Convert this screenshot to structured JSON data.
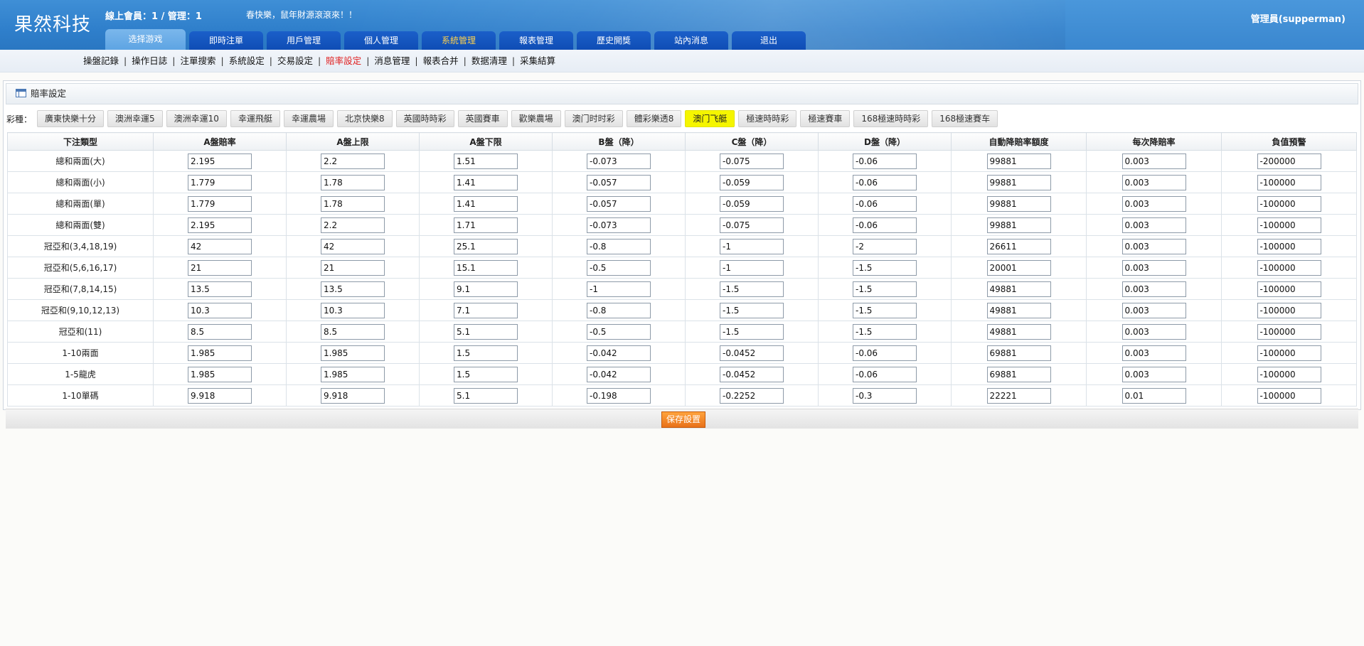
{
  "header": {
    "logo": "果然科技",
    "online_info": "線上會員：1 / 管理：1",
    "marquee": "春快樂，鼠年財源滾滾來！！",
    "admin_info": "管理員(supperman)"
  },
  "nav": [
    "选择游戏",
    "即時注單",
    "用戶管理",
    "個人管理",
    "系統管理",
    "報表管理",
    "歷史開獎",
    "站內消息",
    "退出"
  ],
  "subnav": [
    "操盤記錄",
    "操作日誌",
    "注單搜索",
    "系統設定",
    "交易設定",
    "賠率設定",
    "消息管理",
    "報表合并",
    "数据清理",
    "采集結算"
  ],
  "panel": {
    "title": "賠率設定",
    "lottery_label": "彩種："
  },
  "lotteries": [
    "廣東快樂十分",
    "澳洲幸運5",
    "澳洲幸運10",
    "幸運飛艇",
    "幸運農場",
    "北京快樂8",
    "英國時時彩",
    "英國賽車",
    "歡樂農場",
    "澳门时时彩",
    "體彩樂透8",
    "澳门飞艇",
    "極速時時彩",
    "極速賽車",
    "168極速時時彩",
    "168極速賽车"
  ],
  "active_lottery": "澳门飞艇",
  "table": {
    "headers": [
      "下注類型",
      "A盤賠率",
      "A盤上限",
      "A盤下限",
      "B盤（降）",
      "C盤（降）",
      "D盤（降）",
      "自動降賠率額度",
      "每次降賠率",
      "負值預警"
    ],
    "rows": [
      {
        "type": "總和兩面(大)",
        "values": [
          "2.195",
          "2.2",
          "1.51",
          "-0.073",
          "-0.075",
          "-0.06",
          "99881",
          "0.003",
          "-200000"
        ]
      },
      {
        "type": "總和兩面(小)",
        "values": [
          "1.779",
          "1.78",
          "1.41",
          "-0.057",
          "-0.059",
          "-0.06",
          "99881",
          "0.003",
          "-100000"
        ]
      },
      {
        "type": "總和兩面(單)",
        "values": [
          "1.779",
          "1.78",
          "1.41",
          "-0.057",
          "-0.059",
          "-0.06",
          "99881",
          "0.003",
          "-100000"
        ]
      },
      {
        "type": "總和兩面(雙)",
        "values": [
          "2.195",
          "2.2",
          "1.71",
          "-0.073",
          "-0.075",
          "-0.06",
          "99881",
          "0.003",
          "-100000"
        ]
      },
      {
        "type": "冠亞和(3,4,18,19)",
        "values": [
          "42",
          "42",
          "25.1",
          "-0.8",
          "-1",
          "-2",
          "26611",
          "0.003",
          "-100000"
        ]
      },
      {
        "type": "冠亞和(5,6,16,17)",
        "values": [
          "21",
          "21",
          "15.1",
          "-0.5",
          "-1",
          "-1.5",
          "20001",
          "0.003",
          "-100000"
        ]
      },
      {
        "type": "冠亞和(7,8,14,15)",
        "values": [
          "13.5",
          "13.5",
          "9.1",
          "-1",
          "-1.5",
          "-1.5",
          "49881",
          "0.003",
          "-100000"
        ]
      },
      {
        "type": "冠亞和(9,10,12,13)",
        "values": [
          "10.3",
          "10.3",
          "7.1",
          "-0.8",
          "-1.5",
          "-1.5",
          "49881",
          "0.003",
          "-100000"
        ]
      },
      {
        "type": "冠亞和(11)",
        "values": [
          "8.5",
          "8.5",
          "5.1",
          "-0.5",
          "-1.5",
          "-1.5",
          "49881",
          "0.003",
          "-100000"
        ]
      },
      {
        "type": "1-10兩面",
        "values": [
          "1.985",
          "1.985",
          "1.5",
          "-0.042",
          "-0.0452",
          "-0.06",
          "69881",
          "0.003",
          "-100000"
        ]
      },
      {
        "type": "1-5龍虎",
        "values": [
          "1.985",
          "1.985",
          "1.5",
          "-0.042",
          "-0.0452",
          "-0.06",
          "69881",
          "0.003",
          "-100000"
        ]
      },
      {
        "type": "1-10單碼",
        "values": [
          "9.918",
          "9.918",
          "5.1",
          "-0.198",
          "-0.2252",
          "-0.3",
          "22221",
          "0.01",
          "-100000"
        ]
      }
    ]
  },
  "save_label": "保存設置",
  "colors": {
    "header_blue": "#2f7fcb",
    "nav_tab": "#1b5fc9",
    "active_nav_text": "#ffd24d",
    "active_subnav": "#e02020",
    "active_lottery_bg": "#f5f500",
    "save_button": "#f08a24"
  }
}
